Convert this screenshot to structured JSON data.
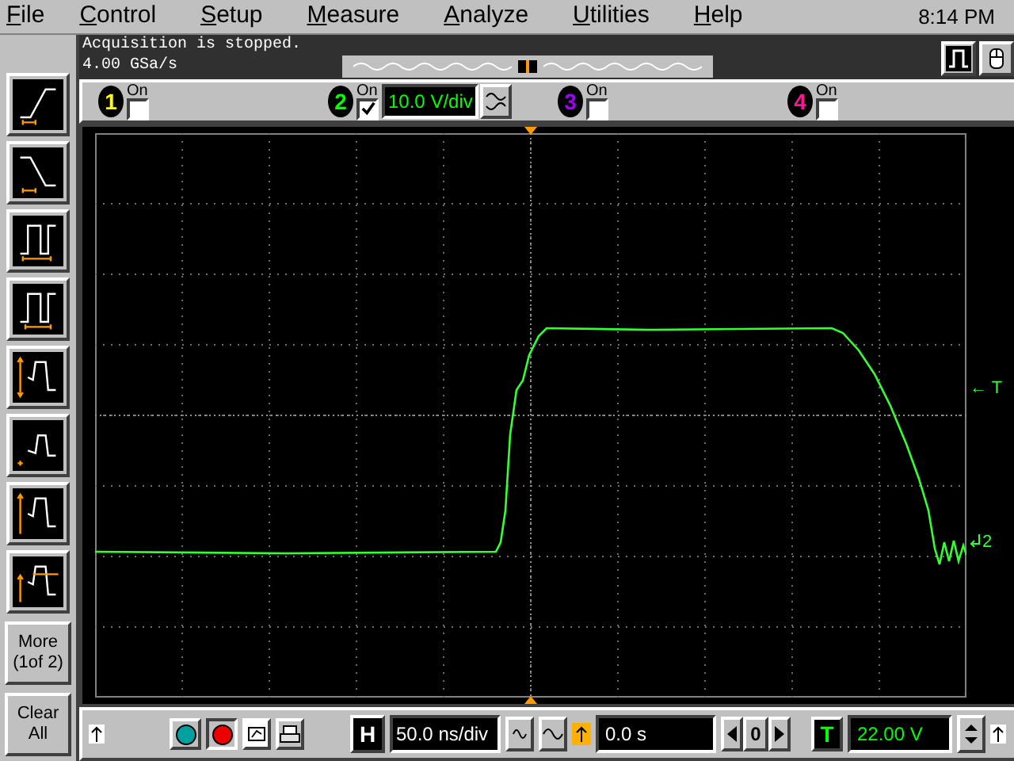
{
  "menu": {
    "items": [
      "File",
      "Control",
      "Setup",
      "Measure",
      "Analyze",
      "Utilities",
      "Help"
    ],
    "clock": "8:14 PM"
  },
  "status": {
    "lines": [
      "Acquisition is stopped.",
      "4.00 GSa/s"
    ]
  },
  "channels": [
    {
      "number": "1",
      "on_label": "On",
      "checked": false,
      "color": "#ffff00"
    },
    {
      "number": "2",
      "on_label": "On",
      "checked": true,
      "color": "#00ff00",
      "scale": "10.0 V/div"
    },
    {
      "number": "3",
      "on_label": "On",
      "checked": false,
      "color": "#a000ff"
    },
    {
      "number": "4",
      "on_label": "On",
      "checked": false,
      "color": "#ff1493"
    }
  ],
  "sidebar": {
    "buttons": [
      "More (1of 2)",
      "Clear All"
    ]
  },
  "plot": {
    "trigger_marker": "← T",
    "ground_marker": "2"
  },
  "bottom": {
    "horizontal_key": "H",
    "timebase": "50.0 ns/div",
    "delay": "0.0 s",
    "center_key": "0",
    "trigger_key": "T",
    "trigger_level": "22.00 V"
  }
}
